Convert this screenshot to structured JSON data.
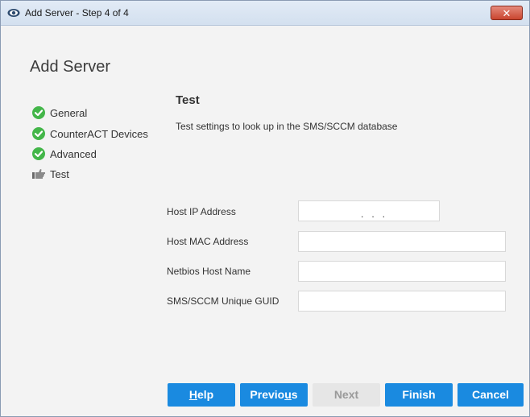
{
  "window": {
    "title": "Add Server - Step 4 of 4",
    "close_glyph": "✕"
  },
  "page": {
    "heading": "Add Server"
  },
  "steps": [
    {
      "label": "General",
      "status": "complete",
      "icon": "check-circle-icon"
    },
    {
      "label": "CounterACT Devices",
      "status": "complete",
      "icon": "check-circle-icon"
    },
    {
      "label": "Advanced",
      "status": "complete",
      "icon": "check-circle-icon"
    },
    {
      "label": "Test",
      "status": "current",
      "icon": "pointing-hand-icon"
    }
  ],
  "section": {
    "title": "Test",
    "description": "Test settings to look up in the SMS/SCCM database"
  },
  "fields": {
    "host_ip": {
      "label": "Host IP Address",
      "value": "   .   .   ."
    },
    "host_mac": {
      "label": "Host MAC Address",
      "value": ""
    },
    "netbios": {
      "label": "Netbios Host Name",
      "value": ""
    },
    "guid": {
      "label": "SMS/SCCM Unique GUID",
      "value": ""
    }
  },
  "buttons": {
    "help": {
      "pre": "",
      "mnemonic": "H",
      "post": "elp"
    },
    "previous": {
      "pre": "Previo",
      "mnemonic": "u",
      "post": "s"
    },
    "next": "Next",
    "finish": "Finish",
    "cancel": "Cancel"
  },
  "colors": {
    "accent": "#1a8ae0",
    "complete": "#43b649",
    "disabled_bg": "#e6e6e6",
    "close": "#c9452f"
  }
}
